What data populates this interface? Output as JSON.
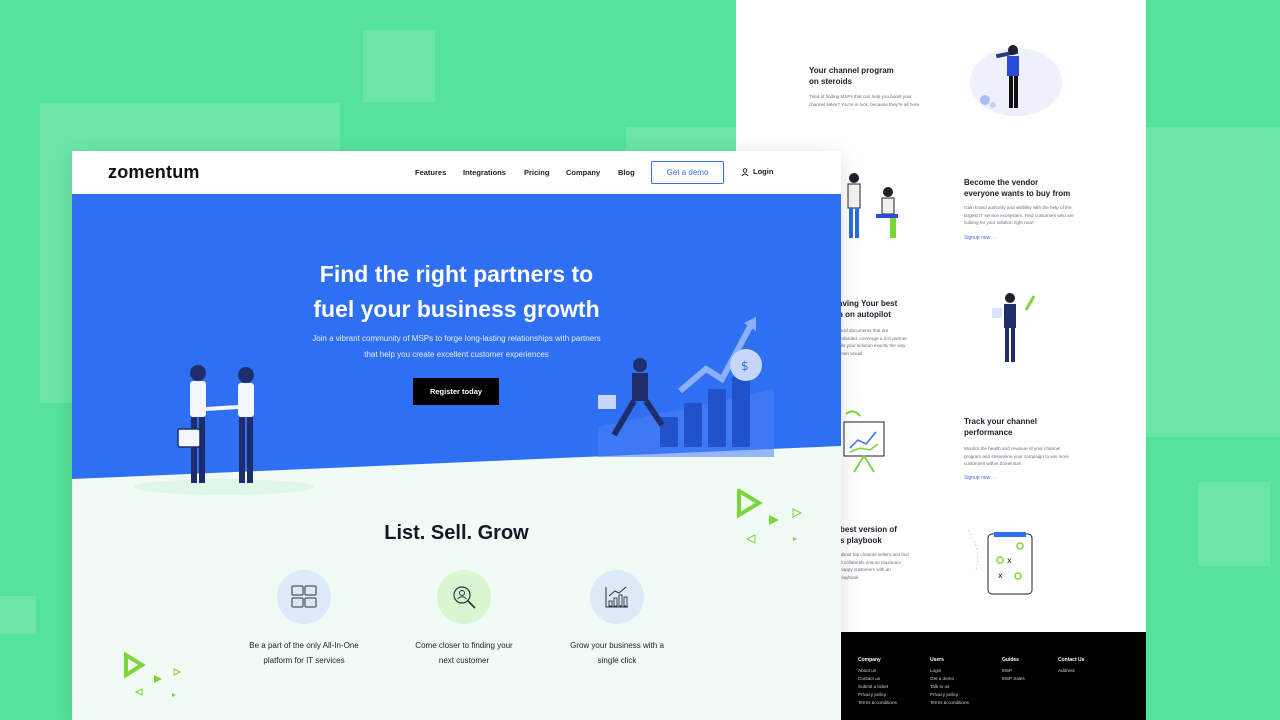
{
  "front": {
    "logo": "zomentum",
    "nav": {
      "items": [
        "Features",
        "Integrations",
        "Pricing",
        "Company",
        "Blog"
      ],
      "demo_button": "Get a demo",
      "login": "Login"
    },
    "hero": {
      "title_line1": "Find the right partners to",
      "title_line2": "fuel your business growth",
      "subtitle_line1": "Join a vibrant community of MSPs to forge long-lasting relationships with partners",
      "subtitle_line2": "that help you create excellent customer experiences",
      "cta": "Register today"
    },
    "section_title": "List. Sell. Grow",
    "features": [
      {
        "line1": "Be a part of the only  All-In-One",
        "line2": "platform for IT services",
        "icon": "grid-icon",
        "bg": "#dceaf7"
      },
      {
        "line1": "Come closer to finding your",
        "line2": "next customer",
        "icon": "search-person-icon",
        "bg": "#d8f6cf"
      },
      {
        "line1": "Grow your business with a",
        "line2": "single click",
        "icon": "chart-growth-icon",
        "bg": "#dceaf7"
      }
    ]
  },
  "back": {
    "sections": [
      {
        "title_l1": "Your channel program",
        "title_l2": "on steroids",
        "desc_l1": "Tired of finding MSPs that can help you boost your",
        "desc_l2": "channel sales?  You're in luck, because they're all here."
      },
      {
        "title_l1": "Become the vendor",
        "title_l2": "everyone wants to buy from",
        "desc_l1": "Gain brand authority and visibility with the help of the",
        "desc_l2": "largest IT service ecosystem. Find customers who are",
        "desc_l3": "looking for your solution right now!",
        "link": "Signup now →"
      },
      {
        "title_l1": "aving Your best",
        "title_l2": "n on autopilot",
        "desc_l1": "and documents that are",
        "desc_l2": "ndarded. Leverage a rich partner",
        "desc_l3": "ills your solution exactly the way",
        "desc_l4": "men would."
      },
      {
        "title_l1": "Track your channel",
        "title_l2": "performance",
        "desc_l1": "Monitor the health and revenue of your channel",
        "desc_l2": "program and streamline your campaign to win more",
        "desc_l3": "customers within Zomentum.",
        "link": "Signup now →"
      },
      {
        "title_l1": "best version of",
        "title_l2": "s playbook",
        "desc_l1": "about top channel sellers and find",
        "desc_l2": "d collaterals ensure maximum",
        "desc_l3": "happy customers with an",
        "desc_l4": "playbook."
      }
    ],
    "footer": {
      "columns": [
        {
          "heading": "Company",
          "items": [
            "About us",
            "Contact us",
            "Submit a ticket",
            "Privacy policy",
            "Terms & conditions"
          ]
        },
        {
          "heading": "Users",
          "items": [
            "Login",
            "Get a demo",
            "Talk to us",
            "Privacy policy",
            "Terms & conditions"
          ]
        },
        {
          "heading": "Guides",
          "items": [
            "MSP",
            "MSP Sales"
          ]
        },
        {
          "heading": "Contact Us",
          "items": [
            "Address"
          ]
        }
      ]
    }
  },
  "colors": {
    "background": "#55e39b",
    "hero_blue": "#2f6ff2",
    "accent_green": "#7bd63a",
    "link_blue": "#3b6ff5"
  }
}
